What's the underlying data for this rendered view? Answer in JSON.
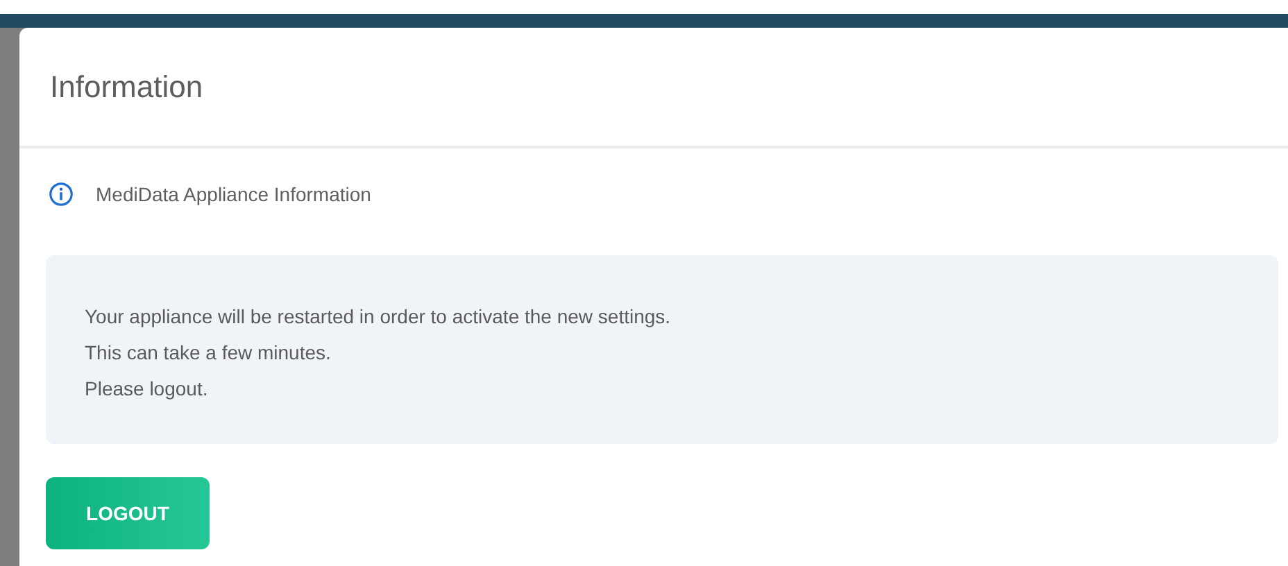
{
  "dialog": {
    "title": "Information",
    "subtitle": "MediData Appliance Information",
    "message_lines": [
      "Your appliance will be restarted in order to activate the new settings.",
      "This can take a few minutes.",
      "Please logout."
    ],
    "buttons": [
      "LOGOUT"
    ]
  }
}
